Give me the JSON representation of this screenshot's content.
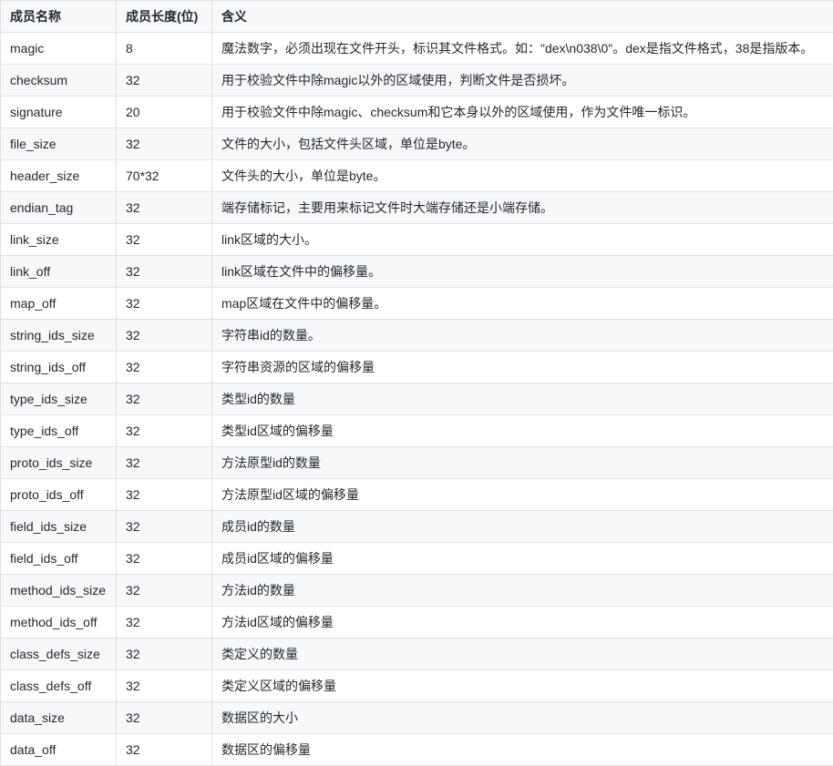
{
  "table": {
    "headers": [
      "成员名称",
      "成员长度(位)",
      "含义"
    ],
    "rows": [
      [
        "magic",
        "8",
        "魔法数字，必须出现在文件开头，标识其文件格式。如：\"dex\\n038\\0\"。dex是指文件格式，38是指版本。"
      ],
      [
        "checksum",
        "32",
        "用于校验文件中除magic以外的区域使用，判断文件是否损坏。"
      ],
      [
        "signature",
        "20",
        "用于校验文件中除magic、checksum和它本身以外的区域使用，作为文件唯一标识。"
      ],
      [
        "file_size",
        "32",
        "文件的大小，包括文件头区域，单位是byte。"
      ],
      [
        "header_size",
        "70*32",
        "文件头的大小，单位是byte。"
      ],
      [
        "endian_tag",
        "32",
        "端存储标记，主要用来标记文件时大端存储还是小端存储。"
      ],
      [
        "link_size",
        "32",
        "link区域的大小。"
      ],
      [
        "link_off",
        "32",
        "link区域在文件中的偏移量。"
      ],
      [
        "map_off",
        "32",
        "map区域在文件中的偏移量。"
      ],
      [
        "string_ids_size",
        "32",
        "字符串id的数量。"
      ],
      [
        "string_ids_off",
        "32",
        "字符串资源的区域的偏移量"
      ],
      [
        "type_ids_size",
        "32",
        "类型id的数量"
      ],
      [
        "type_ids_off",
        "32",
        "类型id区域的偏移量"
      ],
      [
        "proto_ids_size",
        "32",
        "方法原型id的数量"
      ],
      [
        "proto_ids_off",
        "32",
        "方法原型id区域的偏移量"
      ],
      [
        "field_ids_size",
        "32",
        "成员id的数量"
      ],
      [
        "field_ids_off",
        "32",
        "成员id区域的偏移量"
      ],
      [
        "method_ids_size",
        "32",
        "方法id的数量"
      ],
      [
        "method_ids_off",
        "32",
        "方法id区域的偏移量"
      ],
      [
        "class_defs_size",
        "32",
        "类定义的数量"
      ],
      [
        "class_defs_off",
        "32",
        "类定义区域的偏移量"
      ],
      [
        "data_size",
        "32",
        "数据区的大小"
      ],
      [
        "data_off",
        "32",
        "数据区的偏移量"
      ]
    ]
  }
}
